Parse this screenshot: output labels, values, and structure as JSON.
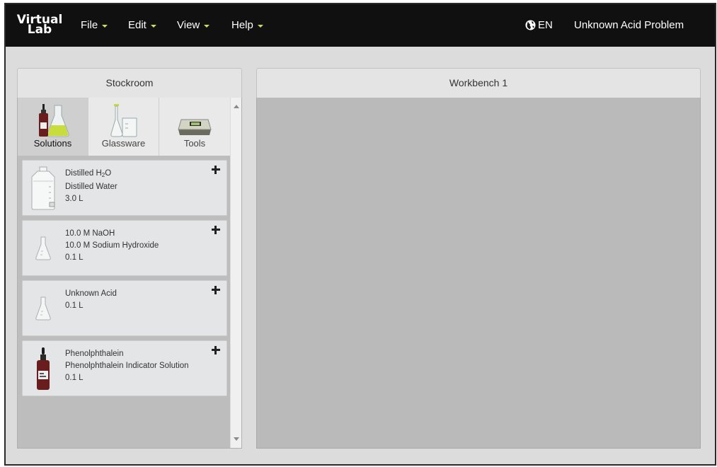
{
  "app": {
    "logo_line1": "Virtual",
    "logo_line2": "Lab"
  },
  "menu": {
    "file": "File",
    "edit": "Edit",
    "view": "View",
    "help": "Help"
  },
  "header": {
    "language": "EN",
    "problem_title": "Unknown Acid Problem"
  },
  "stockroom": {
    "title": "Stockroom",
    "tabs": [
      {
        "label": "Solutions",
        "icon": "solutions-icon",
        "active": true
      },
      {
        "label": "Glassware",
        "icon": "glassware-icon",
        "active": false
      },
      {
        "label": "Tools",
        "icon": "balance-icon",
        "active": false
      }
    ],
    "items": [
      {
        "name_prefix": "Distilled H",
        "name_sub": "2",
        "name_suffix": "O",
        "description": "Distilled Water",
        "volume": "3.0 L",
        "icon": "water-carboy-icon"
      },
      {
        "name": "10.0 M NaOH",
        "description": "10.0 M Sodium Hydroxide",
        "volume": "0.1 L",
        "icon": "flask-icon"
      },
      {
        "name": "Unknown Acid",
        "volume": "0.1 L",
        "icon": "flask-icon"
      },
      {
        "name": "Phenolphthalein",
        "description": "Phenolphthalein Indicator Solution",
        "volume": "0.1 L",
        "icon": "dropper-bottle-icon"
      }
    ]
  },
  "workbench": {
    "title": "Workbench 1"
  },
  "colors": {
    "topbar": "#101010",
    "caret": "#c6e05a",
    "workbench_bg": "#bababa",
    "stock_bg": "#bdbdbd"
  }
}
